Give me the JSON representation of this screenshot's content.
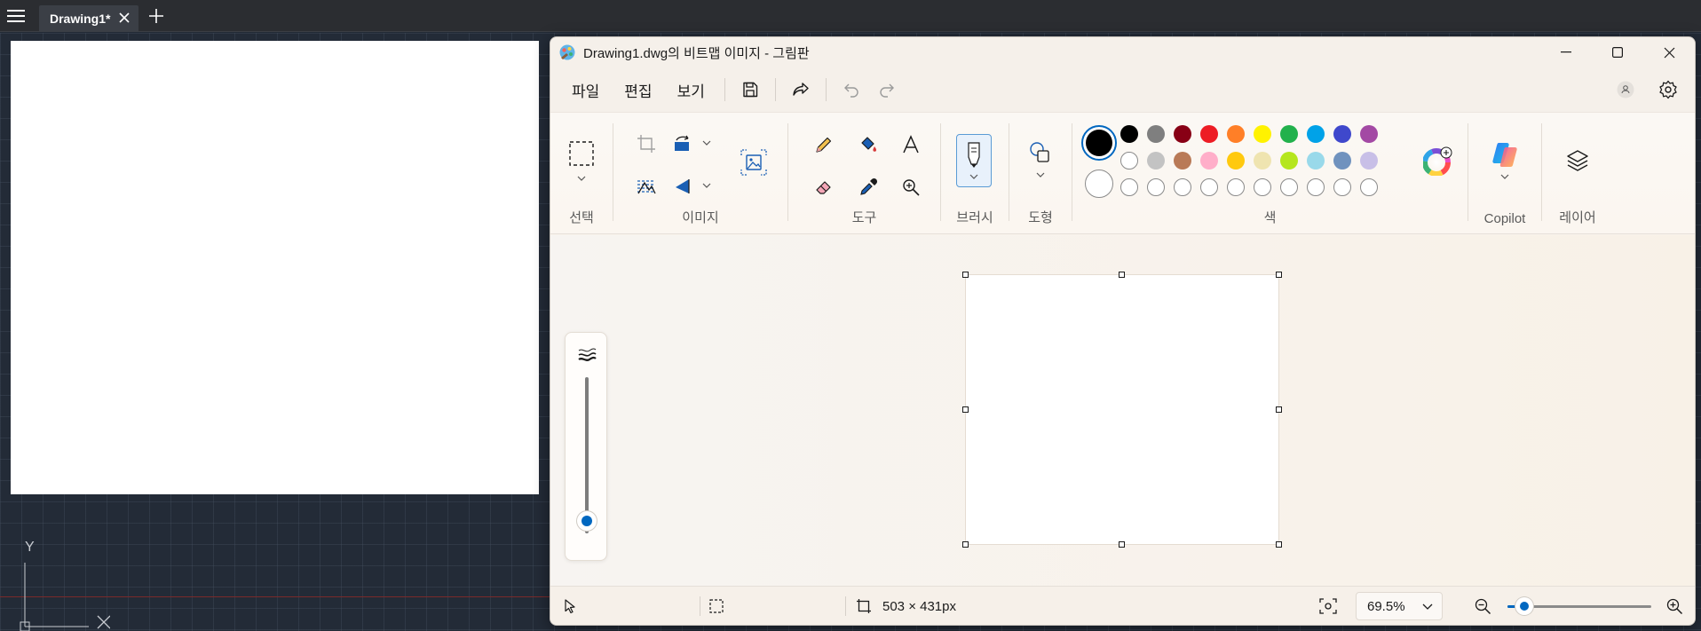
{
  "cad": {
    "tab_title": "Drawing1*",
    "ucs_y_label": "Y"
  },
  "paint": {
    "window_title": "Drawing1.dwg의 비트맵 이미지 - 그림판",
    "menu": [
      "파일",
      "편집",
      "보기"
    ],
    "groups": {
      "select": "선택",
      "image": "이미지",
      "tools": "도구",
      "brush": "브러시",
      "shapes": "도형",
      "colors": "색",
      "copilot": "Copilot",
      "layers": "레이어"
    },
    "colors": {
      "primary": "#000000",
      "secondary": "#ffffff",
      "row1": [
        "#000000",
        "#7f7f7f",
        "#880015",
        "#ed1c24",
        "#ff7f27",
        "#fff200",
        "#22b14c",
        "#00a2e8",
        "#3f48cc",
        "#a349a4"
      ],
      "row2": [
        "#ffffff",
        "#c3c3c3",
        "#b97a57",
        "#ffaec9",
        "#ffc90e",
        "#efe4b0",
        "#b5e61d",
        "#99d9ea",
        "#7092be",
        "#c8bfe7"
      ],
      "row3_empty_count": 10
    },
    "status": {
      "canvas_size": "503 × 431px",
      "zoom": "69.5%",
      "zoom_level": 0.12
    },
    "brush_size_level": 0.08,
    "accent_color": "#0067c0"
  }
}
